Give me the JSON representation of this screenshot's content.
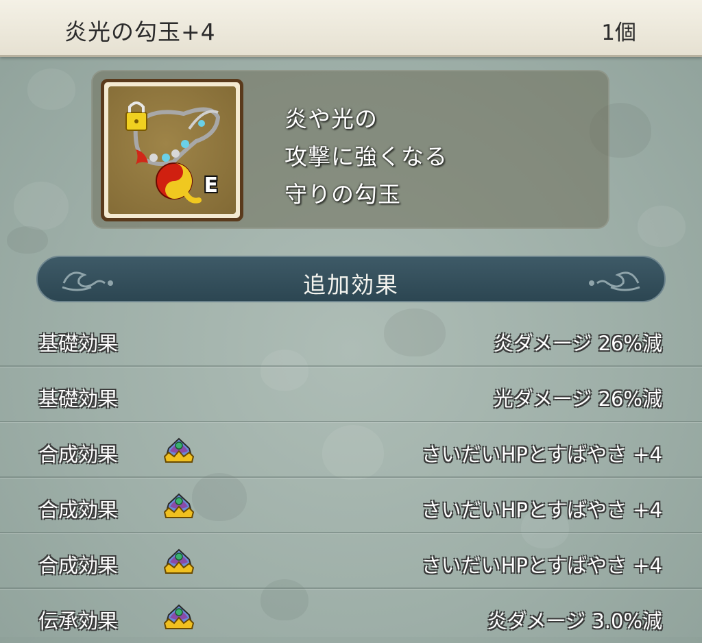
{
  "header": {
    "item_name": "炎光の勾玉+4",
    "count": "1個"
  },
  "item_panel": {
    "icon": "magatama-necklace-icon",
    "equip_badge": "E",
    "description_lines": [
      "炎や光の",
      "攻撃に強くなる",
      "守りの勾玉"
    ]
  },
  "section": {
    "title": "追加効果"
  },
  "effects": [
    {
      "label": "基礎効果",
      "value": "炎ダメージ 26%減",
      "icon": ""
    },
    {
      "label": "基礎効果",
      "value": "光ダメージ 26%減",
      "icon": ""
    },
    {
      "label": "合成効果",
      "value": "さいだいHPとすばやさ +4",
      "icon": "crown-icon"
    },
    {
      "label": "合成効果",
      "value": "さいだいHPとすばやさ +4",
      "icon": "crown-icon"
    },
    {
      "label": "合成効果",
      "value": "さいだいHPとすばやさ +4",
      "icon": "crown-icon"
    },
    {
      "label": "伝承効果",
      "value": "炎ダメージ 3.0%減",
      "icon": "crown-icon"
    }
  ],
  "colors": {
    "background": "#a3b3ac",
    "header_bg": "#efebdf",
    "section_bar": "#34505c",
    "panel": "#77776a"
  }
}
